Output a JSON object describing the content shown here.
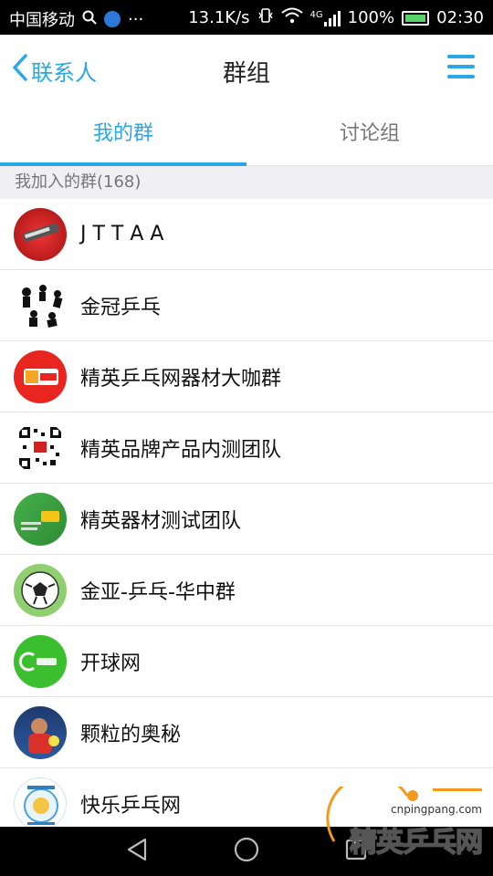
{
  "status_bar": {
    "carrier": "中国移动",
    "speed": "13.1K/s",
    "network": "4G",
    "battery": "100%",
    "time": "02:30"
  },
  "header": {
    "back_label": "联系人",
    "title": "群组"
  },
  "tabs": [
    {
      "label": "我的群",
      "active": true
    },
    {
      "label": "讨论组",
      "active": false
    }
  ],
  "section": {
    "label": "我加入的群(168)"
  },
  "groups": [
    {
      "name": "J T T A A"
    },
    {
      "name": "金冠乒乓"
    },
    {
      "name": "精英乒乓网器材大咖群"
    },
    {
      "name": "精英品牌产品内测团队"
    },
    {
      "name": "精英器材测试团队"
    },
    {
      "name": "金亚-乒乓-华中群"
    },
    {
      "name": "开球网"
    },
    {
      "name": "颗粒的奥秘"
    },
    {
      "name": "快乐乒乓网"
    }
  ],
  "watermark": {
    "domain": "cnpingpang.com",
    "brand": "精英乒乓网"
  },
  "colors": {
    "accent": "#2aa7e6",
    "section_bg": "#efeff4"
  }
}
